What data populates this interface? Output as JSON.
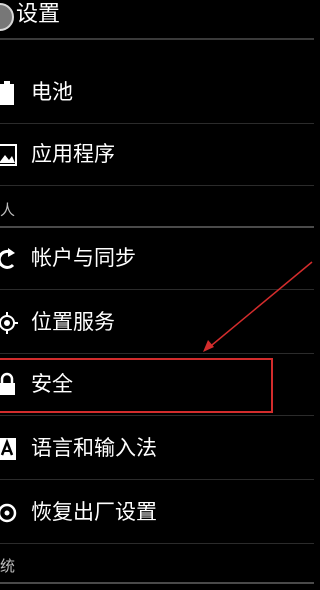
{
  "titlebar": {
    "title": "设置"
  },
  "settings": {
    "battery": "电池",
    "apps": "应用程序",
    "accounts_sync": "帐户与同步",
    "location": "位置服务",
    "security": "安全",
    "language_input": "语言和输入法",
    "factory_reset": "恢复出厂设置"
  },
  "sections": {
    "personal": "人",
    "system": "统"
  },
  "colors": {
    "background": "#000000",
    "highlight": "#d32c2c",
    "divider": "#2b2b2b"
  }
}
